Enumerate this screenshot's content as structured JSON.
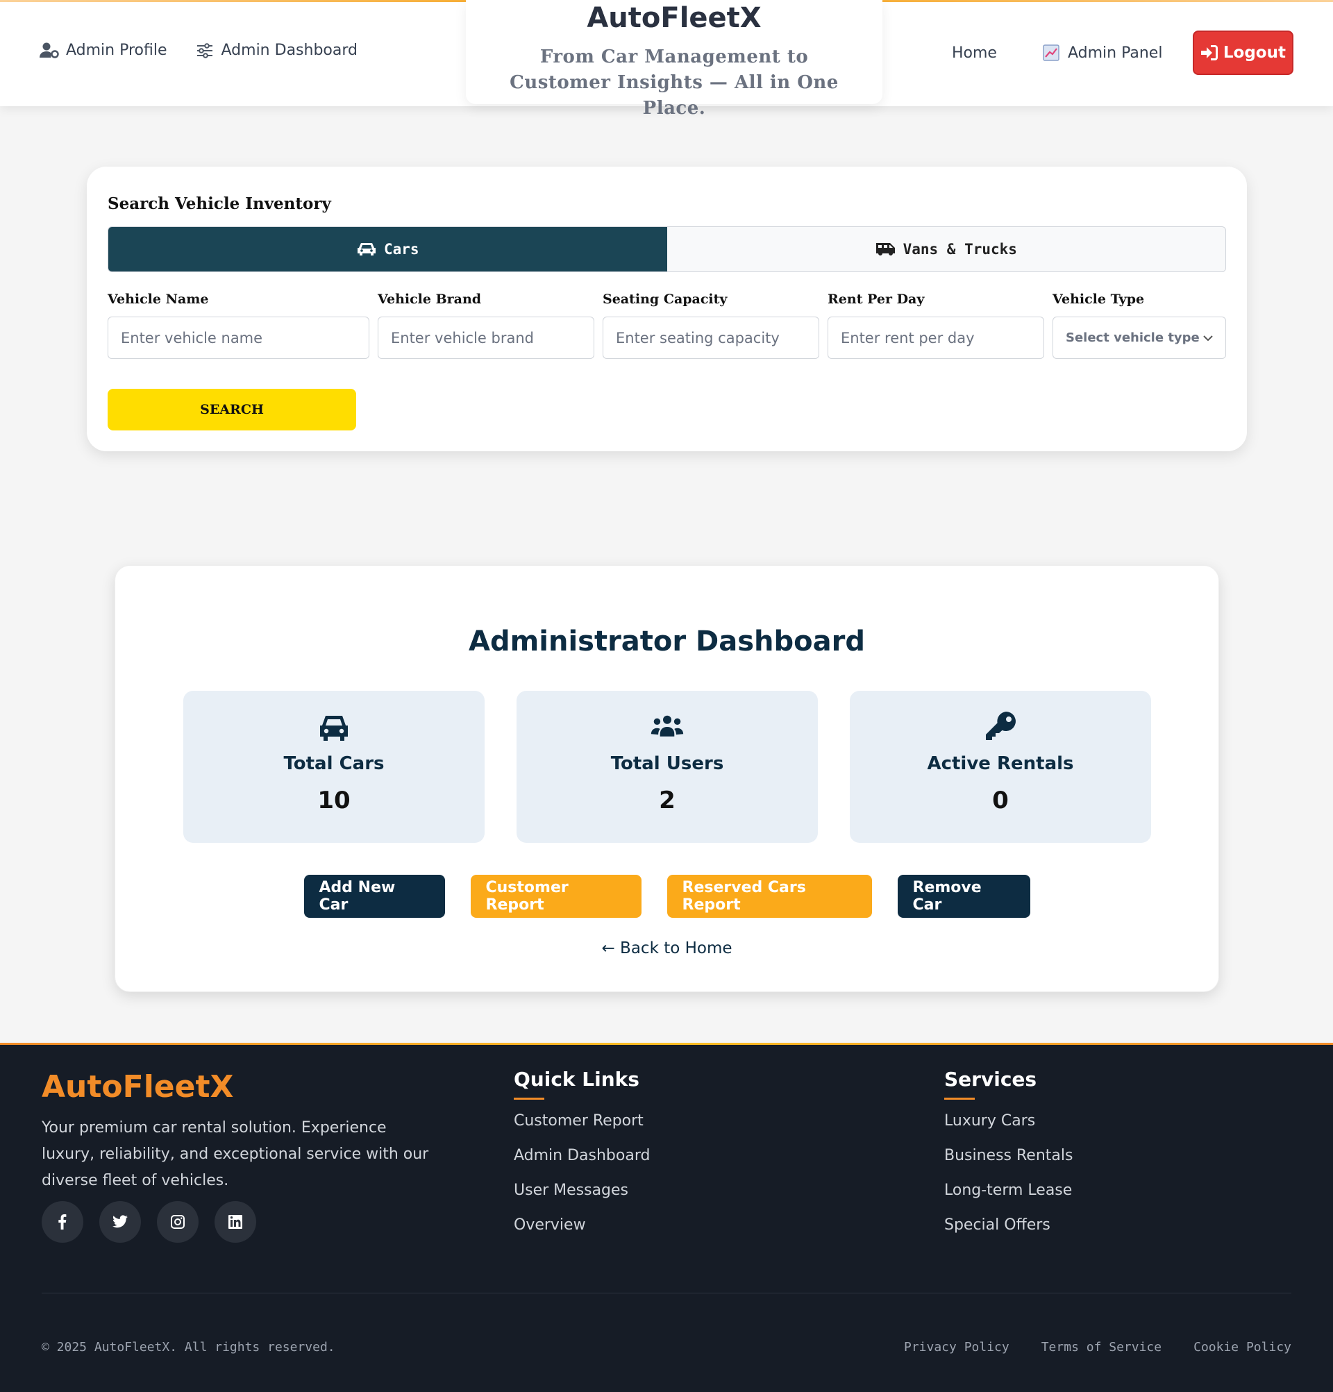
{
  "header": {
    "nav_left": [
      {
        "label": "Admin Profile",
        "icon": "user-cog-icon"
      },
      {
        "label": "Admin Dashboard",
        "icon": "sliders-icon"
      }
    ],
    "brand": "AutoFleetX",
    "tagline": "From Car Management to Customer Insights — All in One Place.",
    "nav_right": {
      "home": "Home",
      "admin_panel": "Admin Panel",
      "admin_panel_icon": "chart-icon",
      "logout": "Logout",
      "logout_icon": "sign-in-icon"
    }
  },
  "search": {
    "title": "Search Vehicle Inventory",
    "tabs": [
      {
        "label": "Cars",
        "icon": "car-icon",
        "active": true
      },
      {
        "label": "Vans & Trucks",
        "icon": "truck-icon",
        "active": false
      }
    ],
    "fields": [
      {
        "label": "Vehicle Name",
        "placeholder": "Enter vehicle name"
      },
      {
        "label": "Vehicle Brand",
        "placeholder": "Enter vehicle brand"
      },
      {
        "label": "Seating Capacity",
        "placeholder": "Enter seating capacity"
      },
      {
        "label": "Rent Per Day",
        "placeholder": "Enter rent per day"
      },
      {
        "label": "Vehicle Type",
        "placeholder": "Select vehicle type"
      }
    ],
    "button": "SEARCH"
  },
  "dashboard": {
    "title": "Administrator Dashboard",
    "stats": [
      {
        "label": "Total Cars",
        "value": "10",
        "icon": "car-icon"
      },
      {
        "label": "Total Users",
        "value": "2",
        "icon": "users-icon"
      },
      {
        "label": "Active Rentals",
        "value": "0",
        "icon": "key-icon"
      }
    ],
    "actions": [
      {
        "label": "Add New Car",
        "style": "dark"
      },
      {
        "label": "Customer Report",
        "style": "orange"
      },
      {
        "label": "Reserved Cars Report",
        "style": "orange"
      },
      {
        "label": "Remove Car",
        "style": "dark"
      }
    ],
    "back_link": "← Back to Home"
  },
  "footer": {
    "brand": "AutoFleetX",
    "description": "Your premium car rental solution. Experience luxury, reliability, and exceptional service with our diverse fleet of vehicles.",
    "socials": [
      "facebook-icon",
      "twitter-icon",
      "instagram-icon",
      "linkedin-icon"
    ],
    "quick_links": {
      "title": "Quick Links",
      "items": [
        "Customer Report",
        "Admin Dashboard",
        "User Messages",
        "Overview"
      ]
    },
    "services": {
      "title": "Services",
      "items": [
        "Luxury Cars",
        "Business Rentals",
        "Long-term Lease",
        "Special Offers"
      ]
    },
    "copyright": "© 2025 AutoFleetX. All rights reserved.",
    "legal": [
      "Privacy Policy",
      "Terms of Service",
      "Cookie Policy"
    ]
  },
  "colors": {
    "primary_dark": "#0d2c42",
    "tab_active": "#1b4555",
    "accent_orange": "#fbaa1a",
    "search_yellow": "#ffdd00",
    "logout_red": "#e53935",
    "footer_bg": "#161c26",
    "footer_brand": "#f28c28"
  }
}
